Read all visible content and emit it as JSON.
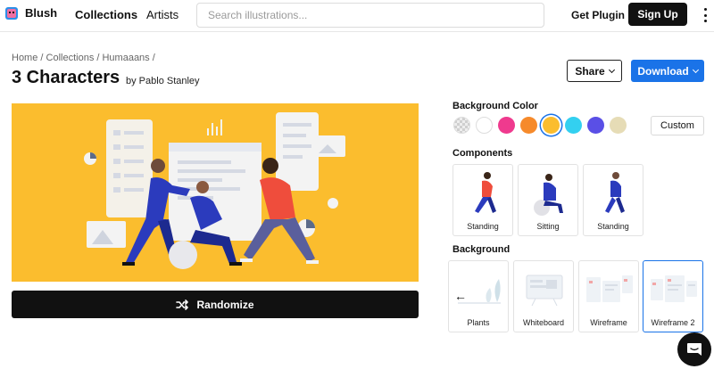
{
  "nav": {
    "logo_text": "Blush",
    "links": [
      "Collections",
      "Artists"
    ],
    "search_placeholder": "Search illustrations...",
    "get_plugin": "Get Plugin",
    "sign_up": "Sign Up"
  },
  "page": {
    "breadcrumb": "Home / Collections / Humaaans /",
    "title": "3 Characters",
    "author": "by Pablo Stanley",
    "share_label": "Share",
    "download_label": "Download",
    "randomize_label": "Randomize"
  },
  "sidebar": {
    "bg_color_label": "Background Color",
    "swatches": [
      "transparent",
      "#ffffff",
      "#ef3a8e",
      "#f68a2b",
      "#fbbd2e",
      "#33d0f0",
      "#5a4fe6",
      "#e6dcb6"
    ],
    "selected_swatch": "#fbbd2e",
    "custom_label": "Custom",
    "components_label": "Components",
    "components": [
      {
        "label": "Standing"
      },
      {
        "label": "Sitting"
      },
      {
        "label": "Standing"
      }
    ],
    "background_label": "Background",
    "backgrounds": [
      {
        "label": "Plants"
      },
      {
        "label": "Whiteboard"
      },
      {
        "label": "Wireframe"
      },
      {
        "label": "Wireframe 2"
      }
    ]
  },
  "colors": {
    "accent": "#1a73e8",
    "canvas_bg": "#fbbd2e",
    "primary_dark": "#111111"
  }
}
